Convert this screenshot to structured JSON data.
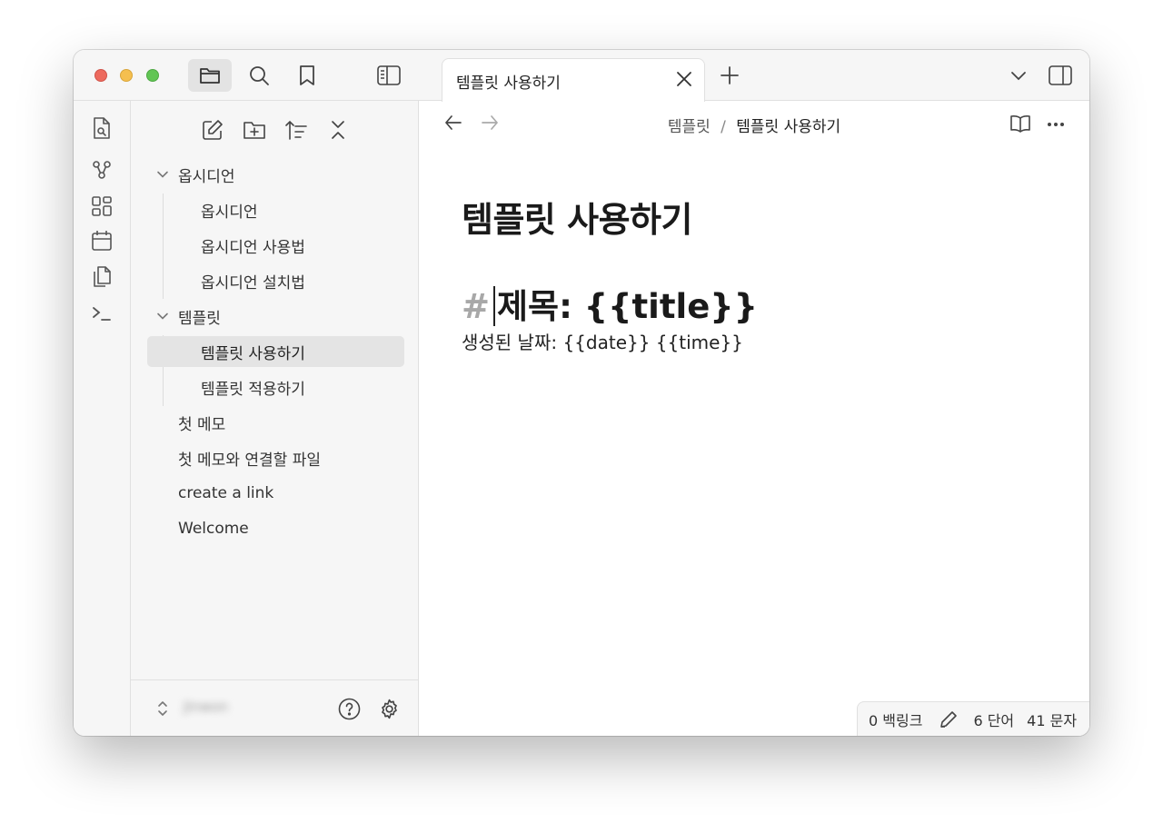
{
  "sidebar": {
    "tree": [
      {
        "type": "folder",
        "label": "옵시디언",
        "children": [
          "옵시디언",
          "옵시디언 사용법",
          "옵시디언 설치법"
        ]
      },
      {
        "type": "folder",
        "label": "템플릿",
        "children": [
          "템플릿 사용하기",
          "템플릿 적용하기"
        ]
      },
      {
        "type": "file",
        "label": "첫 메모"
      },
      {
        "type": "file",
        "label": "첫 메모와 연결할 파일"
      },
      {
        "type": "file",
        "label": "create a link"
      },
      {
        "type": "file",
        "label": "Welcome"
      }
    ],
    "selected": "템플릿 사용하기",
    "vault_name": "Jinwon"
  },
  "tab": {
    "title": "템플릿 사용하기"
  },
  "breadcrumb": {
    "folder": "템플릿",
    "separator": "/",
    "current": "템플릿 사용하기"
  },
  "document": {
    "title": "템플릿 사용하기",
    "heading_marker": "#",
    "heading_text": "제목: {{title}}",
    "body_line": "생성된 날짜: {{date}} {{time}}"
  },
  "status": {
    "backlinks": "0 백링크",
    "words": "6 단어",
    "chars": "41 문자"
  },
  "icons": [
    "folder-icon",
    "search-icon",
    "bookmark-icon",
    "sidebar-toggle-icon",
    "quick-switcher-icon",
    "graph-icon",
    "canvas-icon",
    "calendar-icon",
    "templates-icon",
    "command-palette-icon",
    "new-note-icon",
    "new-folder-icon",
    "sort-icon",
    "collapse-icon",
    "help-icon",
    "settings-icon",
    "reading-view-icon",
    "more-options-icon"
  ]
}
